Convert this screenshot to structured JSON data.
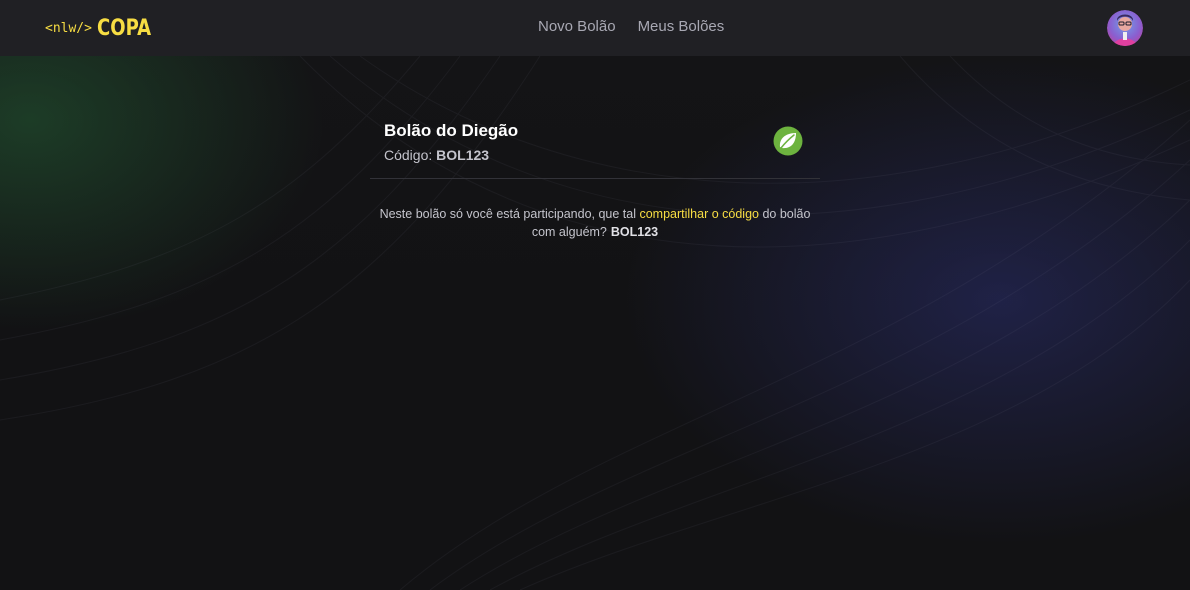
{
  "header": {
    "logo": {
      "tag": "<nlw/>",
      "word": "COPA"
    },
    "nav": [
      {
        "label": "Novo Bolão"
      },
      {
        "label": "Meus Bolões"
      }
    ],
    "avatar_icon": "user-avatar"
  },
  "pool": {
    "title": "Bolão do Diegão",
    "code_label": "Código:",
    "code": "BOL123",
    "icon": "spring-leaf-icon"
  },
  "share": {
    "text_before": "Neste bolão só você está participando, que tal ",
    "link": "compartilhar o código",
    "text_after": " do bolão com alguém?",
    "code": "BOL123"
  },
  "colors": {
    "accent": "#F7DD43",
    "header_bg": "#202024",
    "page_bg": "#121214",
    "nav_text": "#A8A8B3",
    "leaf_green": "#6DB33F"
  }
}
